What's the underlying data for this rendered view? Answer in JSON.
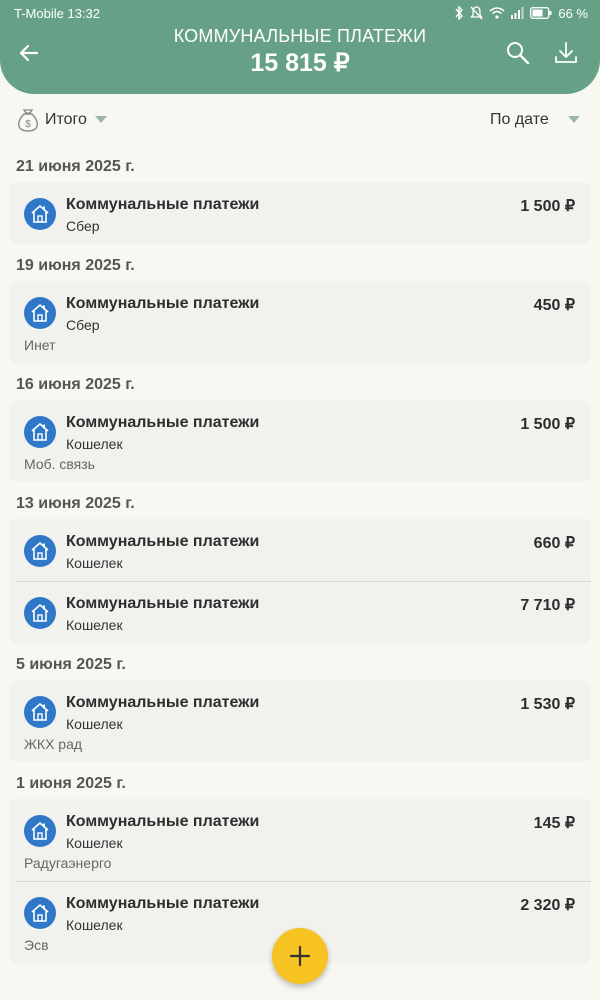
{
  "status": {
    "carrier_time": "T-Mobile 13:32",
    "battery": "66 %"
  },
  "header": {
    "title": "КОММУНАЛЬНЫЕ ПЛАТЕЖИ",
    "total": "15 815 ₽"
  },
  "filter": {
    "group_label": "Итого",
    "sort_label": "По дате"
  },
  "colors": {
    "header": "#66a187",
    "category_icon": "#2f78c8",
    "fab": "#f6c322"
  },
  "groups": [
    {
      "date": "21 июня 2025 г.",
      "entries": [
        {
          "category": "Коммунальные платежи",
          "account": "Сбер",
          "amount": "1 500 ₽",
          "comment": ""
        }
      ]
    },
    {
      "date": "19 июня 2025 г.",
      "entries": [
        {
          "category": "Коммунальные платежи",
          "account": "Сбер",
          "amount": "450 ₽",
          "comment": "Инет"
        }
      ]
    },
    {
      "date": "16 июня 2025 г.",
      "entries": [
        {
          "category": "Коммунальные платежи",
          "account": "Кошелек",
          "amount": "1 500 ₽",
          "comment": "Моб. связь"
        }
      ]
    },
    {
      "date": "13 июня 2025 г.",
      "entries": [
        {
          "category": "Коммунальные платежи",
          "account": "Кошелек",
          "amount": "660 ₽",
          "comment": ""
        },
        {
          "category": "Коммунальные платежи",
          "account": "Кошелек",
          "amount": "7 710 ₽",
          "comment": ""
        }
      ]
    },
    {
      "date": "5 июня 2025 г.",
      "entries": [
        {
          "category": "Коммунальные платежи",
          "account": "Кошелек",
          "amount": "1 530 ₽",
          "comment": "ЖКХ рад"
        }
      ]
    },
    {
      "date": "1 июня 2025 г.",
      "entries": [
        {
          "category": "Коммунальные платежи",
          "account": "Кошелек",
          "amount": "145 ₽",
          "comment": "Радугаэнерго"
        },
        {
          "category": "Коммунальные платежи",
          "account": "Кошелек",
          "amount": "2 320 ₽",
          "comment": "Эсв"
        }
      ]
    }
  ]
}
